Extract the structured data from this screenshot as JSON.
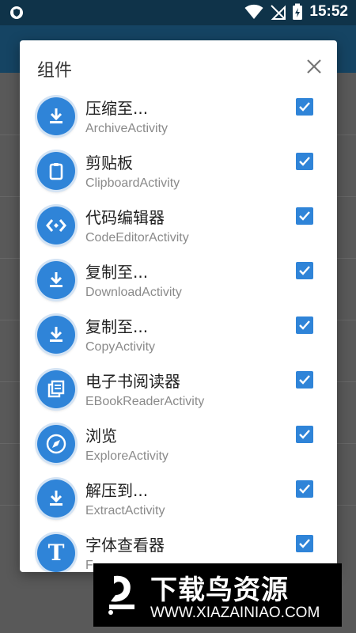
{
  "status_bar": {
    "time": "15:52",
    "icons": [
      "shield-icon",
      "wifi-icon",
      "no-sim-icon",
      "battery-charging-icon"
    ]
  },
  "dialog": {
    "title": "组件",
    "items": [
      {
        "title": "压缩至...",
        "subtitle": "ArchiveActivity",
        "icon": "download-icon",
        "checked": true
      },
      {
        "title": "剪贴板",
        "subtitle": "ClipboardActivity",
        "icon": "clipboard-icon",
        "checked": true
      },
      {
        "title": "代码编辑器",
        "subtitle": "CodeEditorActivity",
        "icon": "code-icon",
        "checked": true
      },
      {
        "title": "复制至...",
        "subtitle": "DownloadActivity",
        "icon": "download-icon",
        "checked": true
      },
      {
        "title": "复制至...",
        "subtitle": "CopyActivity",
        "icon": "download-icon",
        "checked": true
      },
      {
        "title": "电子书阅读器",
        "subtitle": "EBookReaderActivity",
        "icon": "ebook-icon",
        "checked": true
      },
      {
        "title": "浏览",
        "subtitle": "ExploreActivity",
        "icon": "compass-icon",
        "checked": true
      },
      {
        "title": "解压到...",
        "subtitle": "ExtractActivity",
        "icon": "download-icon",
        "checked": true
      },
      {
        "title": "字体查看器",
        "subtitle": "F",
        "icon": "font-icon",
        "checked": true
      }
    ]
  },
  "watermark": {
    "main": "下载鸟资源",
    "url": "WWW.XIAZAINIAO.COM"
  },
  "colors": {
    "accent": "#2f84d8",
    "status_bar": "#0f3349",
    "app_bar": "#154463"
  }
}
